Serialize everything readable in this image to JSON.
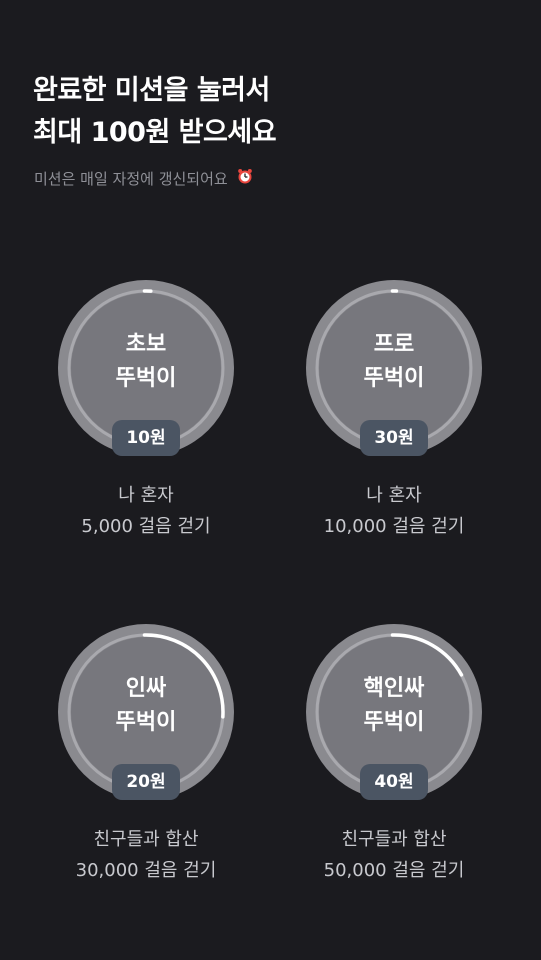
{
  "header": {
    "title_line1": "완료한 미션을 눌러서",
    "title_line2": "최대 100원 받으세요",
    "subtitle": "미션은 매일 자정에 갱신되어요",
    "subtitle_icon": "alarm-clock-icon"
  },
  "missions": [
    {
      "name_line1": "초보",
      "name_line2": "뚜벅이",
      "reward": "10원",
      "condition": "나 혼자",
      "goal": "5,000 걸음 걷기",
      "progress": 0.01
    },
    {
      "name_line1": "프로",
      "name_line2": "뚜벅이",
      "reward": "30원",
      "condition": "나 혼자",
      "goal": "10,000 걸음 걷기",
      "progress": 0.005
    },
    {
      "name_line1": "인싸",
      "name_line2": "뚜벅이",
      "reward": "20원",
      "condition": "친구들과 합산",
      "goal": "30,000 걸음 걷기",
      "progress": 0.26
    },
    {
      "name_line1": "핵인싸",
      "name_line2": "뚜벅이",
      "reward": "40원",
      "condition": "친구들과 합산",
      "goal": "50,000 걸음 걷기",
      "progress": 0.17
    }
  ],
  "colors": {
    "background": "#1b1b1f",
    "ring_outer": "#8a8a8f",
    "ring_inner": "#77777d",
    "ring_track": "#a9a9ae",
    "ring_progress": "#ffffff",
    "reward_badge": "#4b5563"
  }
}
